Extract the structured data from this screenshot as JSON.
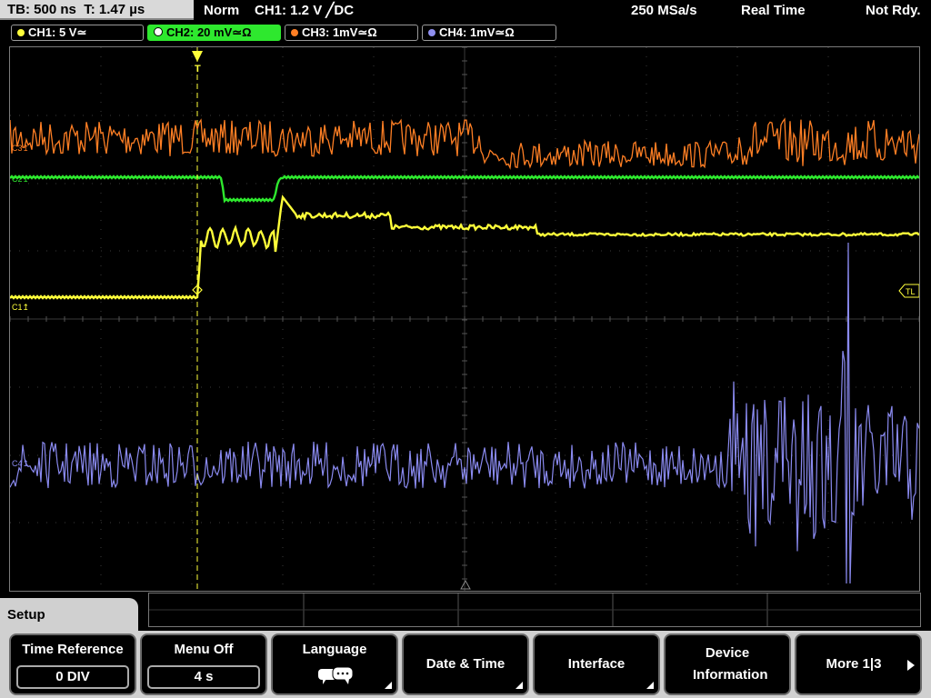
{
  "status": {
    "timebase": "TB: 500 ns",
    "trigger_time": "T: 1.47 µs",
    "mode": "Norm",
    "trigger_info": "CH1: 1.2 V ╱DC",
    "sample_rate": "250 MSa/s",
    "acq_mode": "Real Time",
    "state": "Not Rdy."
  },
  "channels": [
    {
      "label": "CH1: 5 V≃",
      "color": "#ffff3a"
    },
    {
      "label": "CH2: 20 mV≃Ω",
      "color": "#2ee82e"
    },
    {
      "label": "CH3: 1mV≃Ω",
      "color": "#ff7f24"
    },
    {
      "label": "CH4: 1mV≃Ω",
      "color": "#9090f0"
    }
  ],
  "markers": {
    "c1": "C1↥",
    "c2": "C2↥",
    "c3": "C3↥",
    "c4": "C4↥",
    "tl": "TL",
    "trigger": "T"
  },
  "menu": {
    "title": "Setup",
    "buttons": [
      {
        "label": "Time Reference",
        "value": "0 DIV"
      },
      {
        "label": "Menu Off",
        "value": "4 s"
      },
      {
        "label": "Language",
        "icon": "speech-bubble-icon"
      },
      {
        "label": "Date & Time"
      },
      {
        "label": "Interface"
      },
      {
        "label": "Device Information"
      },
      {
        "label": "More 1|3"
      }
    ]
  }
}
